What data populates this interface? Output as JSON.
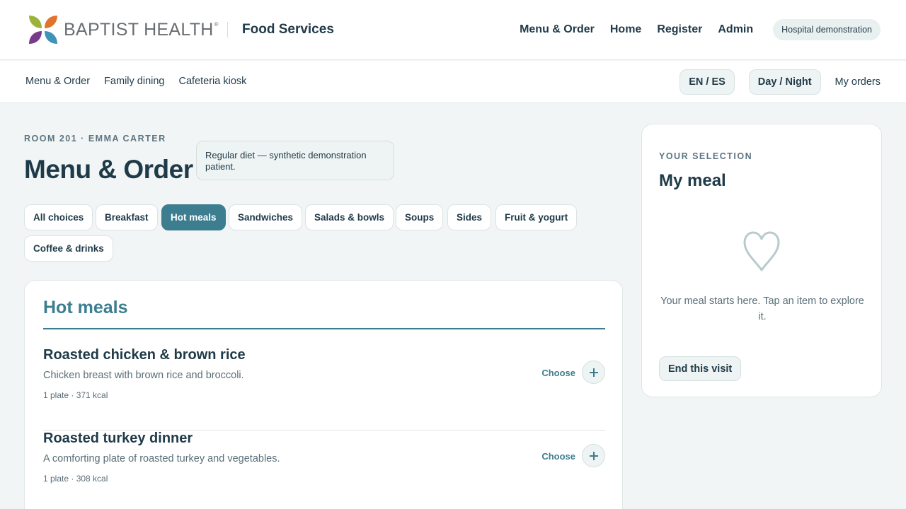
{
  "header": {
    "brand_name": "BAPTIST HEALTH",
    "brand_mark": "®",
    "app_name": "Food Services",
    "nav": [
      "Menu & Order",
      "Home",
      "Register",
      "Admin"
    ],
    "demo_badge": "Hospital demonstration",
    "logo_colors": [
      "#9bb33a",
      "#e0742c",
      "#7a3a8c",
      "#3e93b7"
    ]
  },
  "subnav": {
    "links": [
      "Menu & Order",
      "Family dining",
      "Cafeteria kiosk"
    ],
    "language_toggle": "EN / ES",
    "theme_toggle": "Day / Night",
    "my_orders": "My orders"
  },
  "page": {
    "eyebrow": "ROOM 201 · EMMA CARTER",
    "title": "Menu & Order",
    "diet_note": "Regular diet — synthetic demonstration patient."
  },
  "categories": {
    "items": [
      "All choices",
      "Breakfast",
      "Hot meals",
      "Sandwiches",
      "Salads & bowls",
      "Soups",
      "Sides",
      "Fruit & yogurt",
      "Coffee & drinks"
    ],
    "selected": "Hot meals"
  },
  "menu_section": {
    "title": "Hot meals",
    "items": [
      {
        "name": "Roasted chicken & brown rice",
        "description": "Chicken breast with brown rice and broccoli.",
        "meta": "1 plate · 371 kcal",
        "action": "Choose"
      },
      {
        "name": "Roasted turkey dinner",
        "description": "A comforting plate of roasted turkey and vegetables.",
        "meta": "1 plate · 308 kcal",
        "action": "Choose"
      }
    ]
  },
  "selection": {
    "eyebrow": "YOUR SELECTION",
    "title": "My meal",
    "empty_message": "Your meal starts here. Tap an item to explore it.",
    "end_visit": "End this visit",
    "empty_icon": "heart-icon"
  },
  "colors": {
    "accent": "#3c7d90",
    "text": "#1f3a48",
    "background": "#f1f5f5"
  }
}
